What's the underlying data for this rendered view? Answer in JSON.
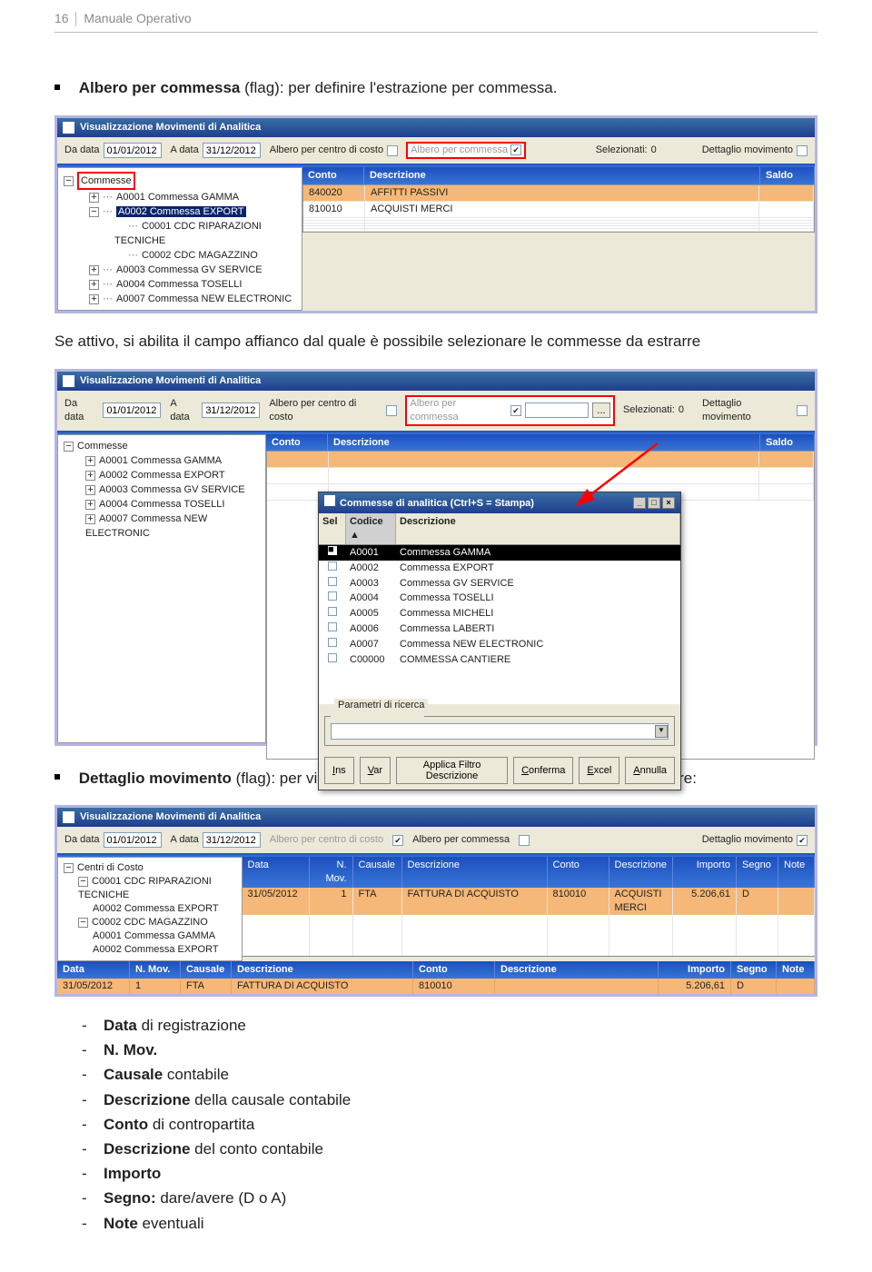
{
  "header": {
    "page_num": "16",
    "manual": "Manuale Operativo"
  },
  "para1_pre": "Albero per commessa",
  "para1_rest": " (flag): per definire l'estrazione per commessa.",
  "para2": "Se attivo, si abilita il campo affianco dal quale è possibile selezionare le commesse da estrarre",
  "para3_pre": "Dettaglio movimento",
  "para3_rest": " (flag): per visualizzare i dati del movimento contabile. In particolare:",
  "win_title": "Visualizzazione Movimenti di Analitica",
  "lbl_dadata": "Da data",
  "lbl_adata": "A data",
  "val_dadata": "01/01/2012",
  "val_adata": "31/12/2012",
  "lbl_albero_cc": "Albero per centro di costo",
  "lbl_albero_comm": "Albero per commessa",
  "lbl_selezionati": "Selezionati:",
  "val_selezionati": "0",
  "lbl_dettaglio": "Dettaglio movimento",
  "lbl_ellipsis": "...",
  "col_conto": "Conto",
  "col_descr": "Descrizione",
  "col_saldo": "Saldo",
  "tree1": {
    "root": "Commesse",
    "items": [
      {
        "exp": "+",
        "label": "A0001 Commessa GAMMA"
      },
      {
        "exp": "−",
        "label": "A0002 Commessa EXPORT",
        "selected": true,
        "children": [
          {
            "label": "C0001 CDC RIPARAZIONI TECNICHE"
          },
          {
            "label": "C0002 CDC MAGAZZINO"
          }
        ]
      },
      {
        "exp": "+",
        "label": "A0003 Commessa GV SERVICE"
      },
      {
        "exp": "+",
        "label": "A0004 Commessa TOSELLI"
      },
      {
        "exp": "+",
        "label": "A0007 Commessa NEW ELECTRONIC"
      }
    ]
  },
  "grid1_rows": [
    {
      "conto": "840020",
      "descr": "AFFITTI PASSIVI"
    },
    {
      "conto": "810010",
      "descr": "ACQUISTI MERCI"
    }
  ],
  "tree2": {
    "root": "Commesse",
    "items": [
      "A0001 Commessa GAMMA",
      "A0002 Commessa EXPORT",
      "A0003 Commessa GV SERVICE",
      "A0004 Commessa TOSELLI",
      "A0007 Commessa NEW ELECTRONIC"
    ]
  },
  "popup": {
    "title": "Commesse di analitica (Ctrl+S = Stampa)",
    "hdr_sel": "Sel",
    "hdr_cod": "Codice",
    "hdr_descr": "Descrizione",
    "sort": "▲",
    "rows": [
      {
        "sel": true,
        "cod": "A0001",
        "descr": "Commessa GAMMA"
      },
      {
        "sel": false,
        "cod": "A0002",
        "descr": "Commessa EXPORT"
      },
      {
        "sel": false,
        "cod": "A0003",
        "descr": "Commessa GV SERVICE"
      },
      {
        "sel": false,
        "cod": "A0004",
        "descr": "Commessa TOSELLI"
      },
      {
        "sel": false,
        "cod": "A0005",
        "descr": "Commessa MICHELI"
      },
      {
        "sel": false,
        "cod": "A0006",
        "descr": "Commessa LABERTI"
      },
      {
        "sel": false,
        "cod": "A0007",
        "descr": "Commessa NEW ELECTRONIC"
      },
      {
        "sel": false,
        "cod": "C00000",
        "descr": "COMMESSA CANTIERE"
      }
    ],
    "params_label": "Parametri di ricerca",
    "btn_ins": "Ins",
    "btn_var": "Var",
    "btn_filtro": "Applica Filtro Descrizione",
    "btn_conf": "Conferma",
    "btn_excel": "Excel",
    "btn_ann": "Annulla",
    "wmin": "_",
    "wmax": "□",
    "wclose": "×"
  },
  "s3": {
    "tree_lbl": "Centri di Costo",
    "tree": [
      {
        "exp": "−",
        "lvl": 1,
        "label": "C0001 CDC RIPARAZIONI TECNICHE"
      },
      {
        "lvl": 2,
        "label": "A0002 Commessa EXPORT"
      },
      {
        "exp": "−",
        "lvl": 1,
        "label": "C0002 CDC MAGAZZINO"
      },
      {
        "lvl": 2,
        "label": "A0001 Commessa GAMMA"
      },
      {
        "lvl": 2,
        "label": "A0002 Commessa EXPORT"
      }
    ],
    "cols": {
      "data": "Data",
      "nmov": "N. Mov.",
      "caus": "Causale",
      "descr": "Descrizione",
      "conto": "Conto",
      "descr2": "Descrizione",
      "imp": "Importo",
      "segno": "Segno",
      "note": "Note"
    },
    "row": {
      "data": "31/05/2012",
      "nmov": "1",
      "caus": "FTA",
      "descr": "FATTURA DI ACQUISTO",
      "conto": "810010",
      "descr2": "ACQUISTI MERCI",
      "imp": "5.206,61",
      "segno": "D",
      "note": ""
    },
    "detail_row": {
      "data": "31/05/2012",
      "nmov": "1",
      "caus": "FTA",
      "descr": "FATTURA DI ACQUISTO",
      "conto": "810010",
      "descr2": "",
      "imp": "5.206,61",
      "segno": "D",
      "note": ""
    }
  },
  "list": [
    {
      "b": "Data",
      "rest": " di registrazione"
    },
    {
      "b": "N. Mov.",
      "rest": ""
    },
    {
      "b": "Causale",
      "rest": " contabile"
    },
    {
      "b": "Descrizione",
      "rest": " della causale contabile"
    },
    {
      "b": "Conto",
      "rest": " di contropartita"
    },
    {
      "b": "Descrizione",
      "rest": " del conto contabile"
    },
    {
      "b": "Importo",
      "rest": ""
    },
    {
      "b": "Segno:",
      "rest": " dare/avere (D o A)"
    },
    {
      "b": "Note",
      "rest": " eventuali"
    }
  ]
}
